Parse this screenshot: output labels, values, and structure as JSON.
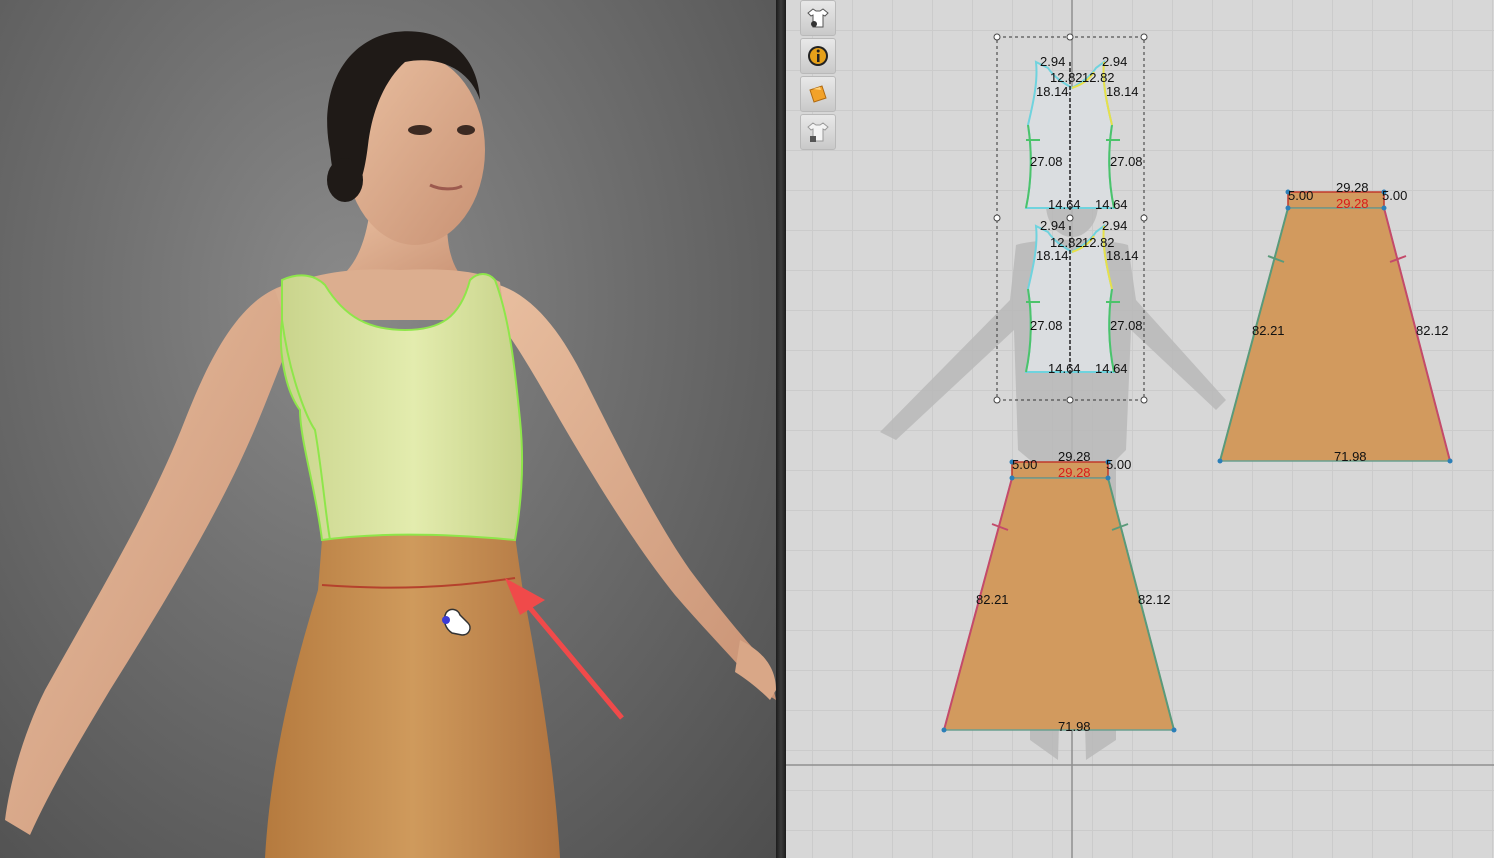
{
  "toolbar": {
    "icons": [
      "garment-view-icon",
      "info-icon",
      "fabric-icon",
      "avatar-lock-icon"
    ]
  },
  "pattern_window": {
    "measurements": {
      "top_front": {
        "shoulder_left": "2.94",
        "shoulder_right": "2.94",
        "neck_left": "12.82",
        "neck_right": "12.82",
        "armhole_left": "18.14",
        "armhole_right": "18.14",
        "side_left": "27.08",
        "side_right": "27.08",
        "hem_left": "14.64",
        "hem_right": "14.64"
      },
      "top_back": {
        "shoulder_left": "2.94",
        "shoulder_right": "2.94",
        "neck_left": "12.82",
        "neck_right": "12.82",
        "armhole_left": "18.14",
        "armhole_right": "18.14",
        "side_left": "27.08",
        "side_right": "27.08",
        "hem_left": "14.64",
        "hem_right": "14.64"
      },
      "waistband_front": {
        "left": "5.00",
        "right": "5.00",
        "top": "29.28",
        "bottom": "29.28"
      },
      "skirt_front": {
        "side_left": "82.21",
        "side_right": "82.12",
        "hem": "71.98"
      },
      "waistband_back": {
        "left": "5.00",
        "right": "5.00",
        "top": "29.28",
        "bottom": "29.28"
      },
      "skirt_back": {
        "side_left": "82.21",
        "side_right": "82.12",
        "hem": "71.98"
      }
    }
  },
  "colors": {
    "top_fabric": "#d9e4a0",
    "top_outline": "#8ee64a",
    "skirt_fabric": "#c8914f",
    "pattern_skirt": "#d29a5e",
    "selected_seam": "#c0392b",
    "arrow": "#f04a4a"
  }
}
